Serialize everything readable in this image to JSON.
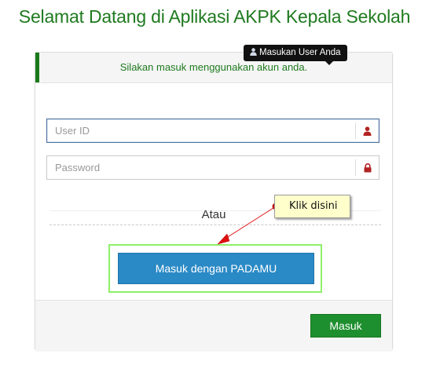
{
  "header": {
    "title": "Selamat Datang di Aplikasi AKPK Kepala Sekolah"
  },
  "notice": {
    "text": "Silakan masuk menggunakan akun anda."
  },
  "tooltip": {
    "text": "Masukan User Anda",
    "icon": "user-icon"
  },
  "form": {
    "user_id": {
      "placeholder": "User ID",
      "value": "",
      "icon": "user-icon"
    },
    "password": {
      "placeholder": "Password",
      "value": "",
      "icon": "lock-icon"
    }
  },
  "separator": {
    "text": "Atau"
  },
  "buttons": {
    "padamu_label": "Masuk dengan PADAMU",
    "submit_label": "Masuk"
  },
  "annotation": {
    "text": "Klik disini"
  },
  "colors": {
    "title_green": "#1f7a1f",
    "padamu_blue": "#2a8ac6",
    "submit_green": "#1e8f2e",
    "icon_red": "#b22222",
    "highlight_green": "#8ef06a",
    "arrow_red": "#e01010"
  }
}
